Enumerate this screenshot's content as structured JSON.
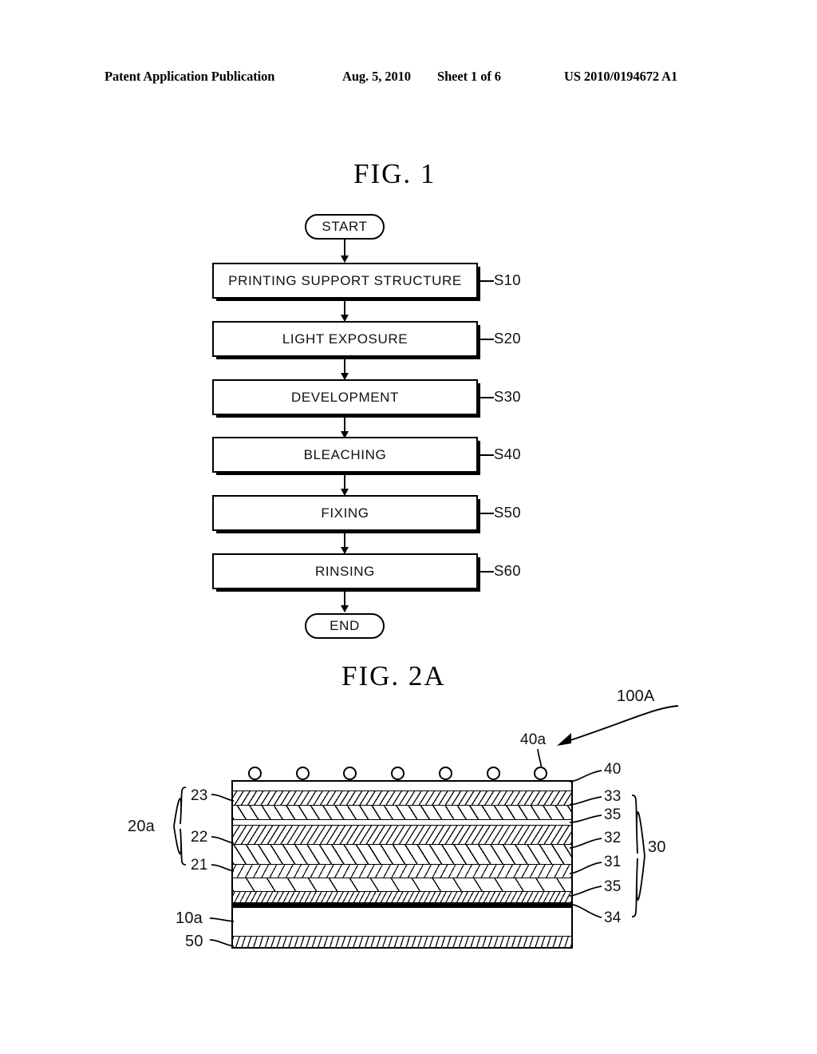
{
  "header": {
    "publication": "Patent Application Publication",
    "date": "Aug. 5, 2010",
    "sheet": "Sheet 1 of 6",
    "patent_number": "US 2010/0194672 A1"
  },
  "figure1": {
    "title": "FIG.  1",
    "start_label": "START",
    "end_label": "END",
    "steps": [
      {
        "label": "PRINTING SUPPORT STRUCTURE",
        "tag": "S10"
      },
      {
        "label": "LIGHT EXPOSURE",
        "tag": "S20"
      },
      {
        "label": "DEVELOPMENT",
        "tag": "S30"
      },
      {
        "label": "BLEACHING",
        "tag": "S40"
      },
      {
        "label": "FIXING",
        "tag": "S50"
      },
      {
        "label": "RINSING",
        "tag": "S60"
      }
    ]
  },
  "figure2a": {
    "title": "FIG.  2A",
    "device_ref": "100A",
    "particle_ref": "40a",
    "left_refs": {
      "group_20a": "20a",
      "item_23": "23",
      "item_22": "22",
      "item_21": "21",
      "item_10a": "10a",
      "item_50": "50"
    },
    "right_refs": {
      "item_40": "40",
      "item_33": "33",
      "item_35_upper": "35",
      "item_32": "32",
      "item_31": "31",
      "item_35_lower": "35",
      "item_34": "34",
      "group_30": "30"
    },
    "particle_count": 7
  },
  "colors": {
    "ink": "#000000",
    "paper": "#ffffff"
  }
}
